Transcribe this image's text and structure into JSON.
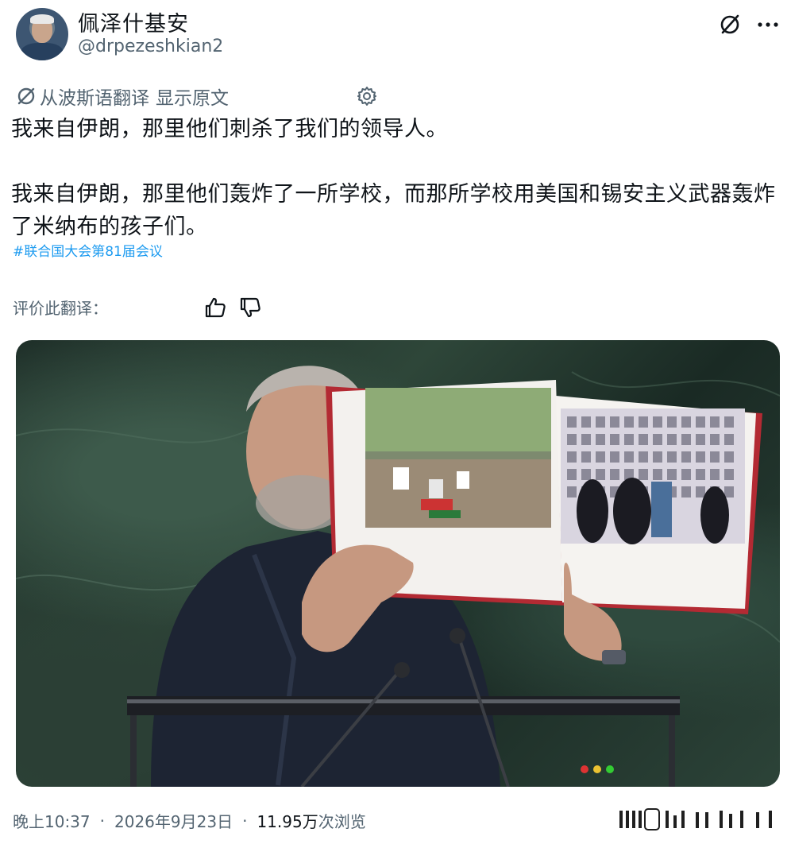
{
  "header": {
    "display_name": "佩泽什基安",
    "handle": "@drpezeshkian2",
    "icons": [
      "grok-icon",
      "more-icon"
    ]
  },
  "translation": {
    "label": "从波斯语翻译",
    "show_original": "显示原文"
  },
  "tweet": {
    "line1": "我来自伊朗，那里他们刺杀了我们的领导人。",
    "line2": "我来自伊朗，那里他们轰炸了一所学校，而那所学校用美国和锡安主义武器轰炸了米纳布的孩子们。",
    "hashtag": "#联合国大会第81届会议"
  },
  "rating": {
    "label": "评价此翻译："
  },
  "media": {
    "alt": ""
  },
  "footer": {
    "time": "晚上10:37",
    "date": "2026年9月23日",
    "views_count": "11.95万",
    "views_label": "次浏览",
    "separator": "·"
  },
  "colors": {
    "link": "#1d9bf0",
    "secondary_text": "#536471",
    "primary_text": "#0f1419"
  }
}
